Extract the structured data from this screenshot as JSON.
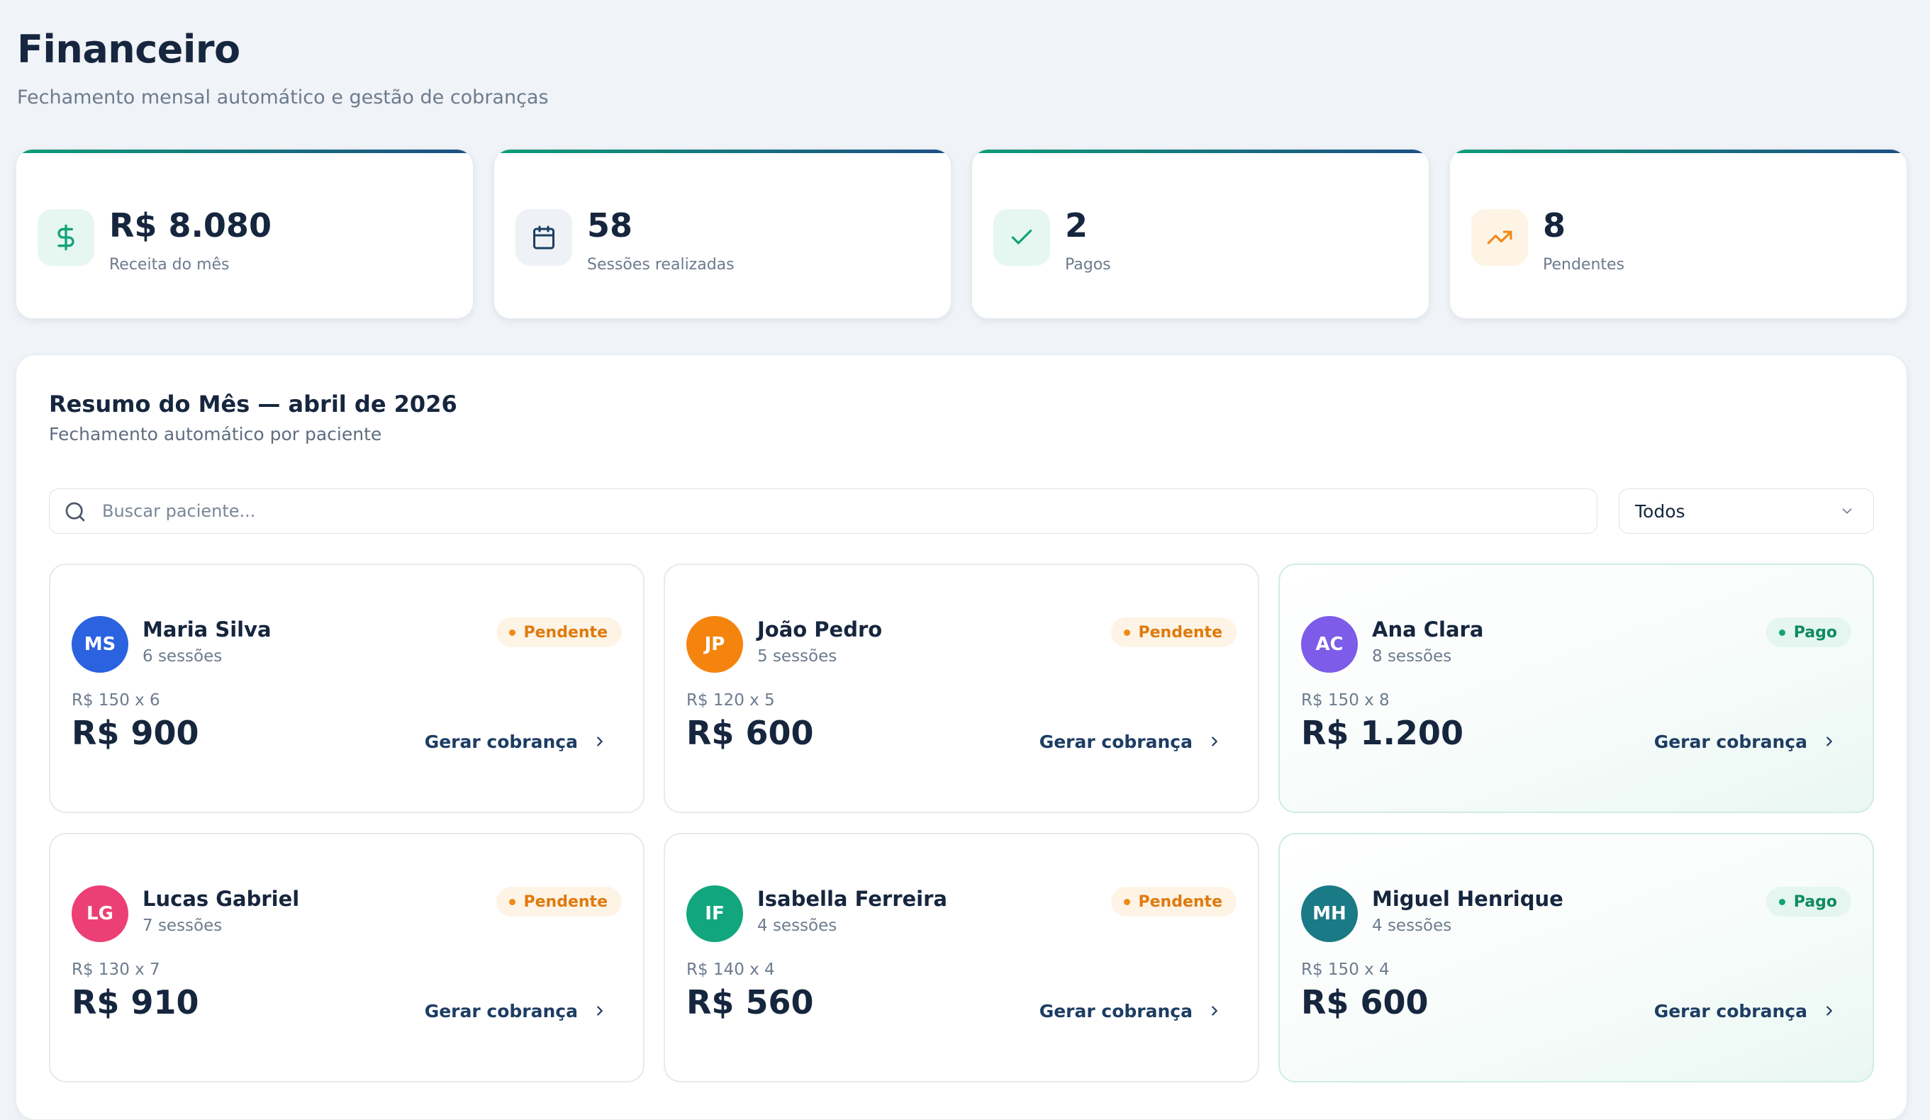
{
  "header": {
    "title": "Financeiro",
    "subtitle": "Fechamento mensal automático e gestão de cobranças"
  },
  "stats": [
    {
      "value": "R$ 8.080",
      "label": "Receita do mês",
      "icon": "dollar-icon",
      "tint": "#e6f7f1",
      "color": "#12a378"
    },
    {
      "value": "58",
      "label": "Sessões realizadas",
      "icon": "calendar-icon",
      "tint": "#eef2f6",
      "color": "#1d3d63"
    },
    {
      "value": "2",
      "label": "Pagos",
      "icon": "check-icon",
      "tint": "#e6f7f1",
      "color": "#12a378"
    },
    {
      "value": "8",
      "label": "Pendentes",
      "icon": "trending-up-icon",
      "tint": "#fdf4e6",
      "color": "#f08a16"
    }
  ],
  "summary": {
    "title": "Resumo do Mês — abril de 2026",
    "subtitle": "Fechamento automático por paciente",
    "search_placeholder": "Buscar paciente...",
    "filter_value": "Todos"
  },
  "patients": [
    {
      "initials": "MS",
      "name": "Maria Silva",
      "sessions": "6 sessões",
      "status": "Pendente",
      "rate": "R$ 150 x 6",
      "total": "R$ 900",
      "action": "Gerar cobrança",
      "avatar_color": "#2a62df"
    },
    {
      "initials": "JP",
      "name": "João Pedro",
      "sessions": "5 sessões",
      "status": "Pendente",
      "rate": "R$ 120 x 5",
      "total": "R$ 600",
      "action": "Gerar cobrança",
      "avatar_color": "#f5840f"
    },
    {
      "initials": "AC",
      "name": "Ana Clara",
      "sessions": "8 sessões",
      "status": "Pago",
      "rate": "R$ 150 x 8",
      "total": "R$ 1.200",
      "action": "Gerar cobrança",
      "avatar_color": "#7c5ce8"
    },
    {
      "initials": "LG",
      "name": "Lucas Gabriel",
      "sessions": "7 sessões",
      "status": "Pendente",
      "rate": "R$ 130 x 7",
      "total": "R$ 910",
      "action": "Gerar cobrança",
      "avatar_color": "#ec3f76"
    },
    {
      "initials": "IF",
      "name": "Isabella Ferreira",
      "sessions": "4 sessões",
      "status": "Pendente",
      "rate": "R$ 140 x 4",
      "total": "R$ 560",
      "action": "Gerar cobrança",
      "avatar_color": "#12a67e"
    },
    {
      "initials": "MH",
      "name": "Miguel Henrique",
      "sessions": "4 sessões",
      "status": "Pago",
      "rate": "R$ 150 x 4",
      "total": "R$ 600",
      "action": "Gerar cobrança",
      "avatar_color": "#1a7a86"
    }
  ]
}
